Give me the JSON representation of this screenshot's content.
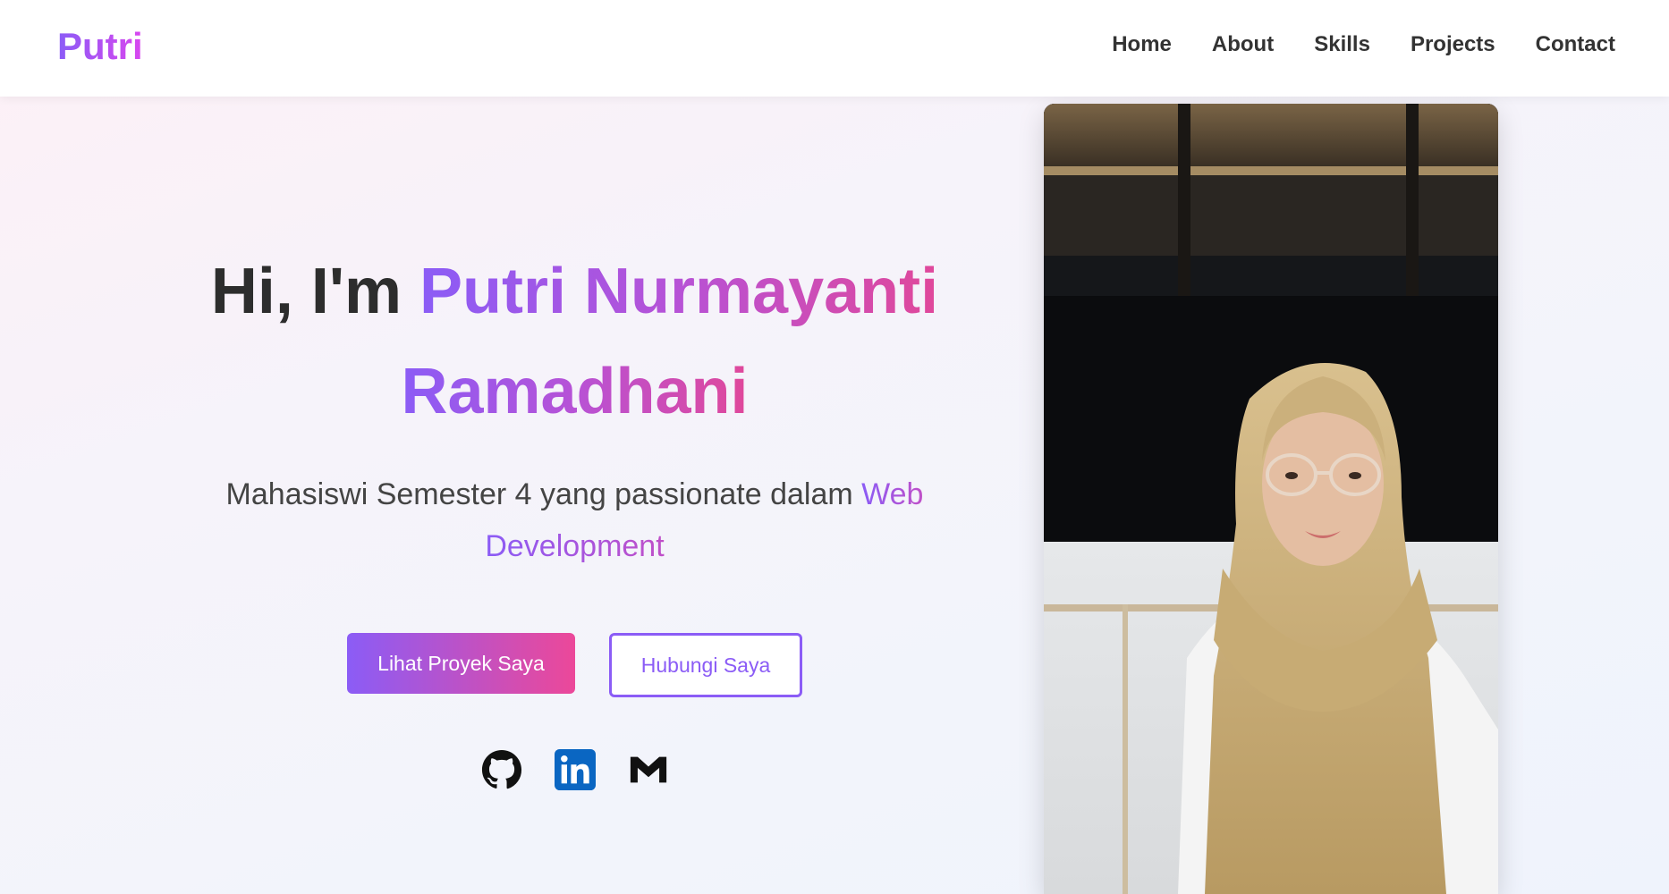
{
  "nav": {
    "logo": "Putri",
    "links": [
      "Home",
      "About",
      "Skills",
      "Projects",
      "Contact"
    ]
  },
  "hero": {
    "greeting": "Hi, I'm ",
    "name_line1": "Putri Nurmayanti",
    "name_line2": "Ramadhani",
    "subtitle": "Mahasiswi Semester 4 yang passionate dalam ",
    "subtitle_accent_1": "Web",
    "subtitle_accent_2": "Development",
    "primary_button": "Lihat Proyek Saya",
    "secondary_button": "Hubungi Saya"
  },
  "social": [
    {
      "icon": "github-icon",
      "color": "#111111"
    },
    {
      "icon": "linkedin-icon",
      "color": "#0a66c2"
    },
    {
      "icon": "gmail-icon",
      "color": "#111111"
    }
  ],
  "colors": {
    "accent_purple": "#8b5cf6",
    "accent_pink": "#ec4899",
    "text_dark": "#2d2d2d"
  }
}
